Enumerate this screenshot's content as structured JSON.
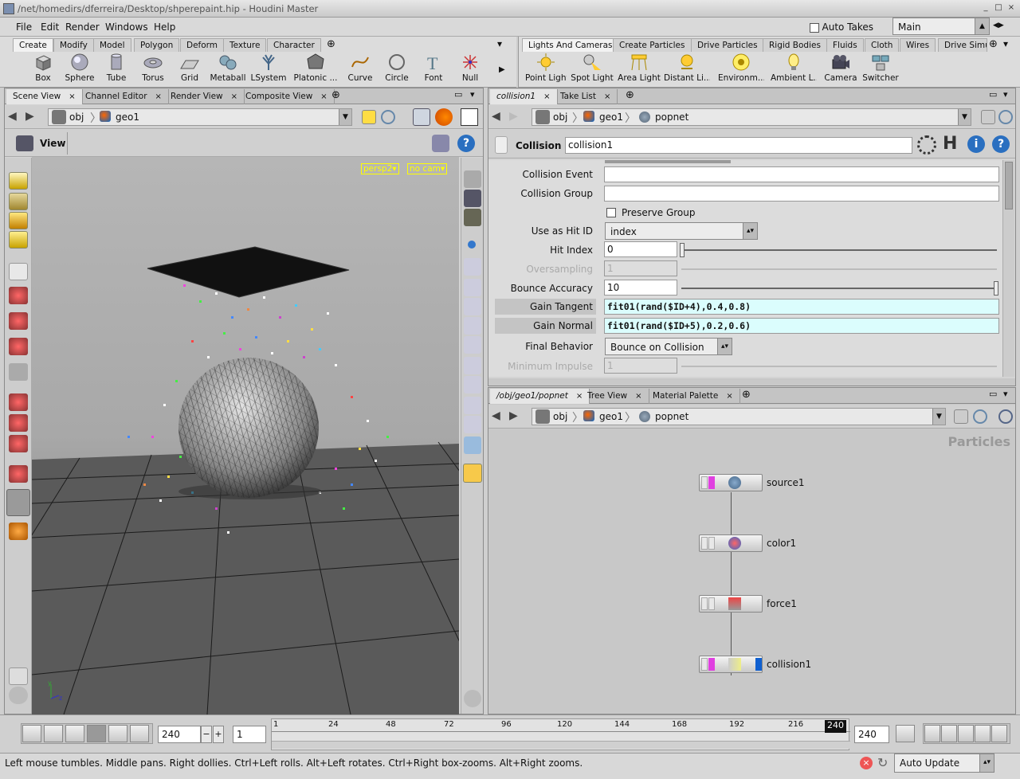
{
  "window": {
    "title": "/net/homedirs/dferreira/Desktop/shperepaint.hip - Houdini Master"
  },
  "menu": {
    "items": [
      "File",
      "Edit",
      "Render",
      "Windows",
      "Help"
    ],
    "auto_takes_label": "Auto Takes",
    "desktop": "Main"
  },
  "shelf_left": {
    "tabs": [
      "Create",
      "Modify",
      "Model",
      "Polygon",
      "Deform",
      "Texture",
      "Character"
    ],
    "tools": [
      "Box",
      "Sphere",
      "Tube",
      "Torus",
      "Grid",
      "Metaball",
      "LSystem",
      "Platonic ...",
      "Curve",
      "Circle",
      "Font",
      "Null"
    ]
  },
  "shelf_right": {
    "tabs": [
      "Lights And Cameras",
      "Create Particles",
      "Drive Particles",
      "Rigid Bodies",
      "Fluids",
      "Cloth",
      "Wires",
      "Drive Simu"
    ],
    "tools": [
      "Point Light",
      "Spot Light",
      "Area Light",
      "Distant Li...",
      "Environm...",
      "Ambient L...",
      "Camera",
      "Switcher"
    ]
  },
  "scene_panel": {
    "tabs": [
      "Scene View",
      "Channel Editor",
      "Render View",
      "Composite View"
    ],
    "path": [
      "obj",
      "geo1"
    ],
    "view_label": "View",
    "cam_menu": "persp2",
    "cam_menu2": "no cam"
  },
  "params_panel": {
    "tabs": [
      "collision1",
      "Take List"
    ],
    "path": [
      "obj",
      "geo1",
      "popnet"
    ],
    "node_type": "Collision",
    "node_name": "collision1",
    "params": {
      "collision_event_label": "Collision Event",
      "collision_event": "",
      "collision_group_label": "Collision Group",
      "collision_group": "",
      "preserve_group_label": "Preserve Group",
      "use_hit_id_label": "Use as Hit ID",
      "use_hit_id": "index",
      "hit_index_label": "Hit Index",
      "hit_index": "0",
      "oversampling_label": "Oversampling",
      "oversampling": "1",
      "bounce_accuracy_label": "Bounce Accuracy",
      "bounce_accuracy": "10",
      "gain_tangent_label": "Gain Tangent",
      "gain_tangent": "fit01(rand($ID+4),0.4,0.8)",
      "gain_normal_label": "Gain Normal",
      "gain_normal": "fit01(rand($ID+5),0.2,0.6)",
      "final_behavior_label": "Final Behavior",
      "final_behavior": "Bounce on Collision",
      "minimum_impulse_label": "Minimum Impulse",
      "minimum_impulse": "1"
    }
  },
  "network_panel": {
    "tabs": [
      "/obj/geo1/popnet",
      "Tree View",
      "Material Palette"
    ],
    "path": [
      "obj",
      "geo1",
      "popnet"
    ],
    "context_label": "Particles",
    "nodes": [
      "source1",
      "color1",
      "force1",
      "collision1"
    ]
  },
  "timeline": {
    "current_frame": "240",
    "step": "1",
    "ticks": [
      "1",
      "24",
      "48",
      "72",
      "96",
      "120",
      "144",
      "168",
      "192",
      "216"
    ],
    "end_marker": "240",
    "end_frame": "240"
  },
  "status": {
    "message": "Left mouse tumbles. Middle pans. Right dollies. Ctrl+Left rolls. Alt+Left rotates. Ctrl+Right box-zooms. Alt+Right zooms.",
    "update_mode": "Auto Update"
  },
  "colors": {
    "expr_field": "#dbfdfd",
    "timeline_marker": "#111111",
    "flag_pink": "#e040e0",
    "flag_blue": "#1060d0"
  }
}
